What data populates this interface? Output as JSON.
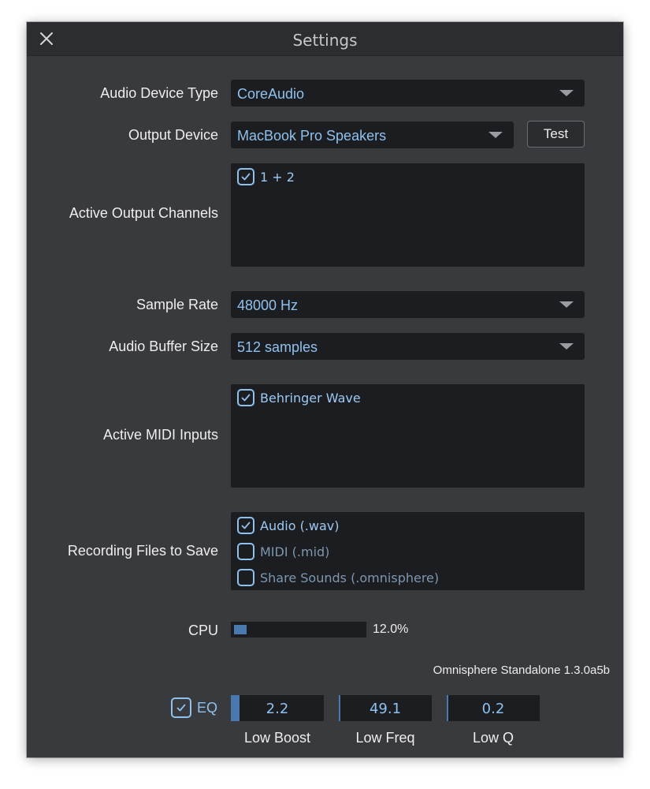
{
  "window": {
    "title": "Settings"
  },
  "audio_device_type": {
    "label": "Audio Device Type",
    "value": "CoreAudio"
  },
  "output_device": {
    "label": "Output Device",
    "value": "MacBook Pro Speakers",
    "test_label": "Test"
  },
  "active_output_channels": {
    "label": "Active Output Channels",
    "items": [
      {
        "label": "1 + 2",
        "checked": true
      }
    ]
  },
  "sample_rate": {
    "label": "Sample Rate",
    "value": "48000 Hz"
  },
  "buffer_size": {
    "label": "Audio Buffer Size",
    "value": "512 samples"
  },
  "midi_inputs": {
    "label": "Active MIDI Inputs",
    "items": [
      {
        "label": "Behringer Wave",
        "checked": true
      }
    ]
  },
  "recording_files": {
    "label": "Recording Files to Save",
    "items": [
      {
        "label": "Audio (.wav)",
        "checked": true
      },
      {
        "label": "MIDI (.mid)",
        "checked": false
      },
      {
        "label": "Share Sounds (.omnisphere)",
        "checked": false
      }
    ]
  },
  "cpu": {
    "label": "CPU",
    "percent_text": "12.0%",
    "level": 0.1
  },
  "version": "Omnisphere Standalone 1.3.0a5b",
  "eq": {
    "label": "EQ",
    "enabled": true,
    "knobs": [
      {
        "label": "Low Boost",
        "value": "2.2",
        "level": 0.09
      },
      {
        "label": "Low Freq",
        "value": "49.1",
        "level": 0.02
      },
      {
        "label": "Low Q",
        "value": "0.2",
        "level": 0.02
      }
    ]
  },
  "colors": {
    "accent": "#8fc1ee",
    "panel": "#393a3e",
    "field": "#1c1d21",
    "meter": "#4a79b0"
  },
  "icons": {
    "close": "close-icon",
    "check": "checkmark-icon",
    "caret": "chevron-down-icon"
  }
}
